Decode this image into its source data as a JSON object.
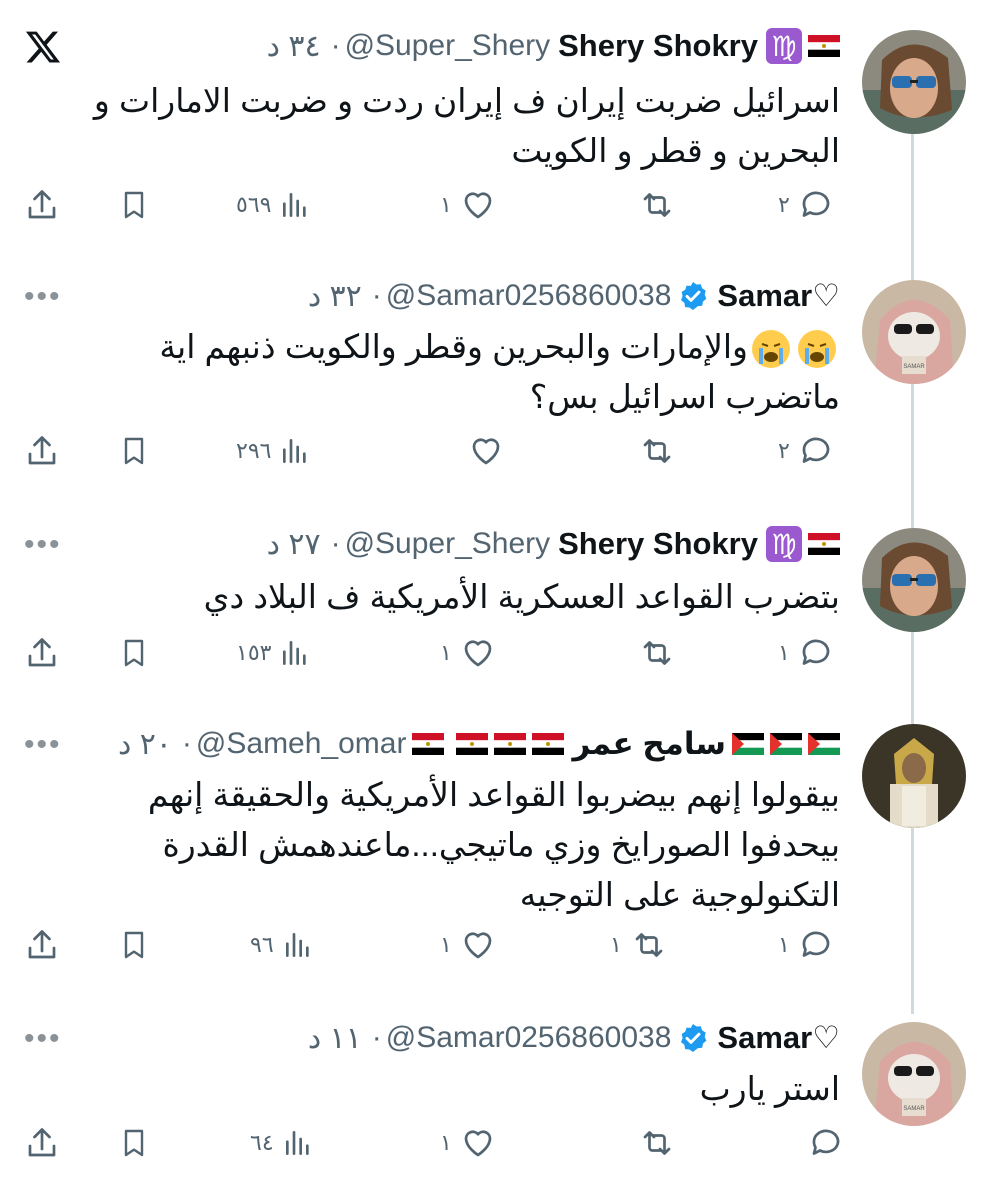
{
  "tweets": [
    {
      "name": "Shery Shokry",
      "handle": "@Super_Shery",
      "sep": "·",
      "time": "٣٤ د",
      "lines": [
        "اسرائيل ضربت إيران ف إيران ردت و ضربت الامارات و",
        "البحرين و قطر و الكويت"
      ],
      "replies": "٢",
      "retweets": "",
      "likes": "١",
      "views": "٥٦٩"
    },
    {
      "name": "Samar♡",
      "handle": "@Samar0256860038",
      "sep": "·",
      "time": "٣٢ د",
      "lines": [
        "والإمارات والبحرين وقطر والكويت ذنبهم اية",
        "ماتضرب اسرائيل بس؟"
      ],
      "replies": "٢",
      "retweets": "",
      "likes": "",
      "views": "٢٩٦"
    },
    {
      "name": "Shery Shokry",
      "handle": "@Super_Shery",
      "sep": "·",
      "time": "٢٧ د",
      "lines": [
        "بتضرب القواعد العسكرية الأمريكية ف البلاد دي"
      ],
      "replies": "١",
      "retweets": "",
      "likes": "١",
      "views": "١٥٣"
    },
    {
      "name": "سامح عمر",
      "handle": "@Sameh_omar",
      "sep": "·",
      "time": "٢٠ د",
      "lines": [
        "بيقولوا إنهم بيضربوا القواعد الأمريكية والحقيقة إنهم",
        "بيحدفوا الصورايخ وزي ماتيجي...ماعندهمش القدرة",
        "التكنولوجية على التوجيه"
      ],
      "replies": "١",
      "retweets": "١",
      "likes": "١",
      "views": "٩٦"
    },
    {
      "name": "Samar♡",
      "handle": "@Samar0256860038",
      "sep": "·",
      "time": "١١ د",
      "lines": [
        "استر يارب"
      ],
      "replies": "",
      "retweets": "",
      "likes": "١",
      "views": "٦٤"
    }
  ],
  "icons": {
    "logo": "x-logo-icon",
    "more": "more-icon",
    "reply": "reply-icon",
    "retweet": "retweet-icon",
    "like": "heart-icon",
    "views": "views-icon",
    "bookmark": "bookmark-icon",
    "share": "share-icon"
  },
  "colors": {
    "text": "#0f1419",
    "secondary": "#536471",
    "verified": "#1d9bf0",
    "thread_line": "#cfd9de"
  }
}
